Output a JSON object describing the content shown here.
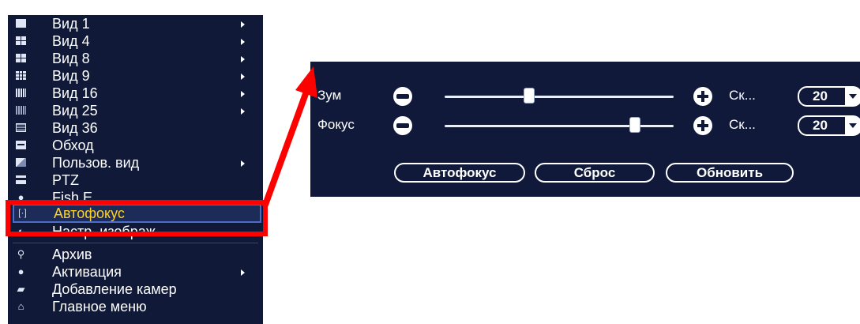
{
  "menu": {
    "items": [
      {
        "label": "Вид 1",
        "icon": "view-1-icon",
        "submenu": true
      },
      {
        "label": "Вид 4",
        "icon": "view-4-icon",
        "submenu": true
      },
      {
        "label": "Вид 8",
        "icon": "view-8-icon",
        "submenu": true
      },
      {
        "label": "Вид 9",
        "icon": "view-9-icon",
        "submenu": true
      },
      {
        "label": "Вид 16",
        "icon": "view-16-icon",
        "submenu": true
      },
      {
        "label": "Вид 25",
        "icon": "view-25-icon",
        "submenu": true
      },
      {
        "label": "Вид 36",
        "icon": "view-36-icon",
        "submenu": false
      },
      {
        "label": "Обход",
        "icon": "tour-icon",
        "submenu": false
      },
      {
        "label": "Пользов. вид",
        "icon": "custom-view-icon",
        "submenu": true
      },
      {
        "label": "PTZ",
        "icon": "ptz-icon",
        "submenu": false
      },
      {
        "label": "Fish E...",
        "icon": "fisheye-icon",
        "submenu": false
      },
      {
        "label": "Автофокус",
        "icon": "autofocus-icon",
        "submenu": false,
        "highlighted": true
      },
      {
        "label": "Настр. изображ.",
        "icon": "image-settings-icon",
        "submenu": false
      },
      {
        "label": "Архив",
        "icon": "search-icon",
        "submenu": false
      },
      {
        "label": "Активация",
        "icon": "activation-icon",
        "submenu": true
      },
      {
        "label": "Добавление камер",
        "icon": "add-camera-icon",
        "submenu": false
      },
      {
        "label": "Главное меню",
        "icon": "home-icon",
        "submenu": false
      }
    ]
  },
  "focus_panel": {
    "zoom_label": "Зум",
    "focus_label": "Фокус",
    "speed_label": "Ск...",
    "zoom_speed": "20",
    "focus_speed": "20",
    "zoom_level": 0.37,
    "focus_level": 0.83,
    "autofocus_label": "Автофокус",
    "reset_label": "Сброс",
    "refresh_label": "Обновить"
  },
  "colors": {
    "menu_bg": "#101a38",
    "panel_bg": "#10193a",
    "highlight_text": "#ffd21f",
    "annotation": "#ff0000"
  }
}
